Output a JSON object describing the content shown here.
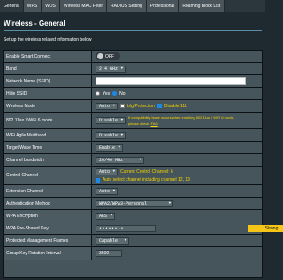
{
  "tabs": [
    {
      "label": "General"
    },
    {
      "label": "WPS"
    },
    {
      "label": "WDS"
    },
    {
      "label": "Wireless MAC Filter"
    },
    {
      "label": "RADIUS Setting"
    },
    {
      "label": "Professional"
    },
    {
      "label": "Roaming Block List"
    }
  ],
  "title": "Wireless - General",
  "subtitle": "Set up the wireless related information below",
  "rows": {
    "smart_connect": {
      "label": "Enable Smart Connect",
      "toggle": "OFF"
    },
    "band": {
      "label": "Band",
      "value": "2.4 GHz"
    },
    "ssid": {
      "label": "Network Name (SSID)",
      "value": ""
    },
    "hide_ssid": {
      "label": "Hide SSID",
      "yes": "Yes",
      "no": "No"
    },
    "wireless_mode": {
      "label": "Wireless Mode",
      "value": "Auto",
      "opt1": "b/g Protection",
      "opt2": "Disable 11b"
    },
    "ax_mode": {
      "label": "802.11ax / WiFi 6 mode",
      "value": "Disable",
      "note": "If compatibility issue occurs when enabling 802.11ax / WiFi 6 mode,",
      "note2": "please check:",
      "faq": "FAQ"
    },
    "agile": {
      "label": "WiFi Agile Multiband",
      "value": "Disable"
    },
    "twt": {
      "label": "Target Wake Time",
      "value": "Enable"
    },
    "bandwidth": {
      "label": "Channel bandwidth",
      "value": "20/40 MHz"
    },
    "control_channel": {
      "label": "Control Channel",
      "value": "Auto",
      "current": "Current Control Channel: 6",
      "auto_note": "Auto select channel including channel 12, 13"
    },
    "ext_channel": {
      "label": "Extension Channel",
      "value": "Auto"
    },
    "auth": {
      "label": "Authentication Method",
      "value": "WPA2/WPA3-Personal"
    },
    "encryption": {
      "label": "WPA Encryption",
      "value": "AES"
    },
    "psk": {
      "label": "WPA Pre-Shared Key",
      "value": "••••••••",
      "strength": "Strong"
    },
    "pmf": {
      "label": "Protected Management Frames",
      "value": "Capable"
    },
    "rotation": {
      "label": "Group Key Rotation Interval",
      "value": "3600"
    }
  }
}
